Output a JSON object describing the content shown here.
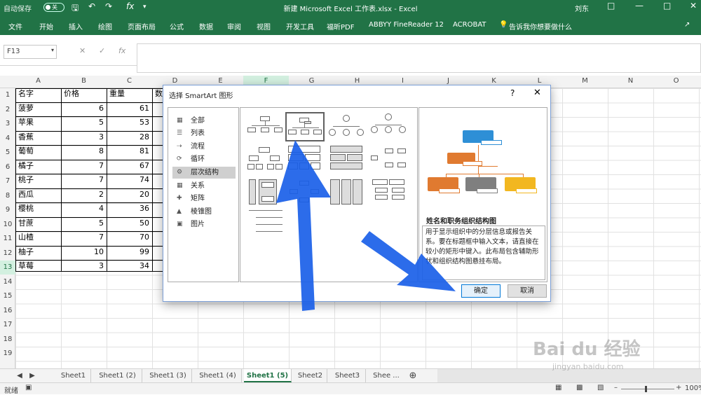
{
  "titlebar": {
    "autosave": "自动保存",
    "autosave_state": "关",
    "title": "新建 Microsoft Excel 工作表.xlsx  -  Excel",
    "user": "刘东",
    "qa_fx": "fx"
  },
  "ribbon": {
    "tabs": [
      "文件",
      "开始",
      "插入",
      "绘图",
      "页面布局",
      "公式",
      "数据",
      "审阅",
      "视图",
      "开发工具",
      "福昕PDF",
      "ABBYY FineReader 12",
      "ACROBAT",
      "告诉我你想要做什么"
    ]
  },
  "formula": {
    "namebox": "F13",
    "fx": "fx"
  },
  "columns": [
    "A",
    "B",
    "C",
    "D",
    "E",
    "F",
    "G",
    "H",
    "I",
    "J",
    "K",
    "L",
    "M",
    "N",
    "O"
  ],
  "selected_column": "F",
  "rows": [
    "1",
    "2",
    "3",
    "4",
    "5",
    "6",
    "7",
    "8",
    "9",
    "10",
    "11",
    "12",
    "13",
    "14",
    "15",
    "16",
    "17",
    "18",
    "19"
  ],
  "selected_row": "13",
  "table": {
    "headers": [
      "名字",
      "价格",
      "重量",
      "数"
    ],
    "rows": [
      [
        "菠萝",
        "6",
        "61"
      ],
      [
        "苹果",
        "5",
        "53"
      ],
      [
        "香蕉",
        "3",
        "28"
      ],
      [
        "葡萄",
        "8",
        "81"
      ],
      [
        "橘子",
        "7",
        "67"
      ],
      [
        "桃子",
        "7",
        "74"
      ],
      [
        "西瓜",
        "2",
        "20"
      ],
      [
        "樱桃",
        "4",
        "36"
      ],
      [
        "甘蔗",
        "5",
        "50"
      ],
      [
        "山楂",
        "7",
        "70"
      ],
      [
        "柚子",
        "10",
        "99"
      ],
      [
        "草莓",
        "3",
        "34"
      ]
    ]
  },
  "sheets": [
    "Sheet1",
    "Sheet1 (2)",
    "Sheet1 (3)",
    "Sheet1 (4)",
    "Sheet1 (5)",
    "Sheet2",
    "Sheet3",
    "Shee ..."
  ],
  "active_sheet": "Sheet1 (5)",
  "status": {
    "ready": "就绪",
    "zoom": "100%"
  },
  "dialog": {
    "title": "选择 SmartArt 图形",
    "help": "?",
    "categories": [
      "全部",
      "列表",
      "流程",
      "循环",
      "层次结构",
      "关系",
      "矩阵",
      "棱锥图",
      "图片"
    ],
    "selected_category": "层次结构",
    "preview_title": "姓名和职务组织结构图",
    "preview_desc": "用于显示组织中的分层信息或报告关系。要在标题框中输入文本，请直接在较小的矩形中键入。此布局包含辅助形状和组织结构图悬挂布局。",
    "ok": "确定",
    "cancel": "取消"
  },
  "colors": {
    "excel_green": "#217346",
    "arrow_blue": "#1a5fe8",
    "preview_blue": "#2e8fd6",
    "preview_orange": "#e07a30",
    "preview_gray": "#7f7f7f",
    "preview_yellow": "#f2b720"
  },
  "watermark": {
    "main": "Bai du 经验",
    "sub": "jingyan.baidu.com"
  }
}
